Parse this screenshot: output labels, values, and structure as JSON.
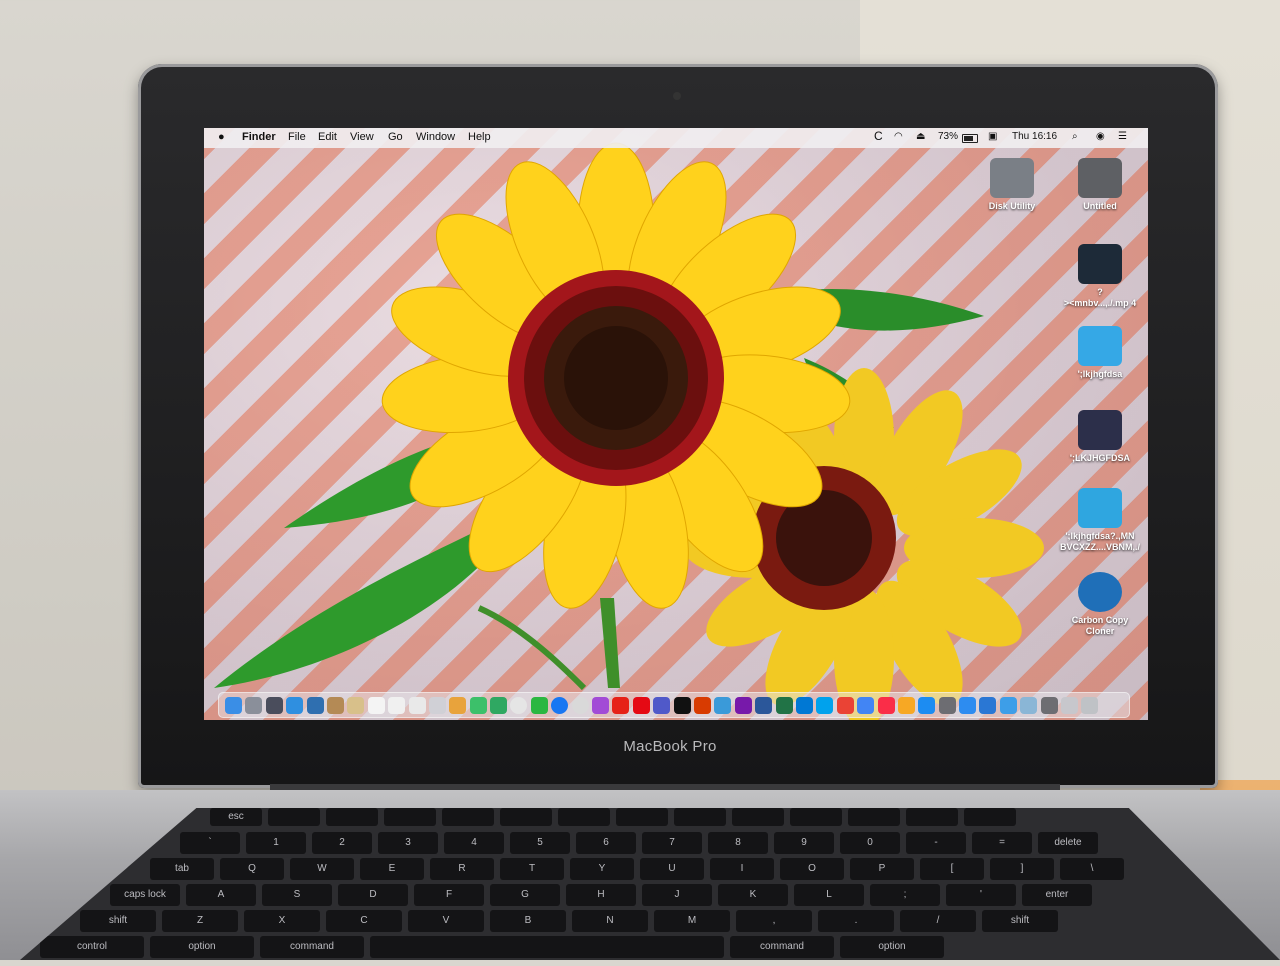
{
  "menubar": {
    "apple_icon": "apple-icon",
    "items": [
      "Finder",
      "File",
      "Edit",
      "View",
      "Go",
      "Window",
      "Help"
    ],
    "battery_percent": "73%",
    "clock": "Thu 16:16"
  },
  "desktop_icons": [
    {
      "label": "Disk Utility",
      "icon": "disk-utility-icon",
      "color": "#7a7f86"
    },
    {
      "label": "Untitled",
      "icon": "drive-icon",
      "color": "#5e6064"
    },
    {
      "label": "?\n><mnbv...,./.mp 4",
      "icon": "video-file-icon",
      "color": "#1d2a38"
    },
    {
      "label": "';lkjhgfdsa",
      "icon": "folder-icon",
      "color": "#35a8e6"
    },
    {
      "label": "';LKJHGFDSA",
      "icon": "keyboard-icon",
      "color": "#2c2f4a"
    },
    {
      "label": "';lkjhgfdsa?.,MN\nBVCXZZ....VBNM,./",
      "icon": "app-icon",
      "color": "#2fa6e0"
    },
    {
      "label": "Carbon Copy\nCloner",
      "icon": "carbon-copy-cloner-icon",
      "color": "#1f6fb8"
    }
  ],
  "dock": {
    "icons": [
      {
        "name": "finder-icon",
        "color": "#3a8ee6"
      },
      {
        "name": "launchpad-icon",
        "color": "#8a8f9a"
      },
      {
        "name": "rocket-icon",
        "color": "#4a4d5c"
      },
      {
        "name": "safari-icon",
        "color": "#2f8fe0"
      },
      {
        "name": "preview-icon",
        "color": "#2f6fb0"
      },
      {
        "name": "mail-icon",
        "color": "#b48a55"
      },
      {
        "name": "notes-icon",
        "color": "#d8c08a"
      },
      {
        "name": "calendar-icon",
        "color": "#f4f4f4"
      },
      {
        "name": "reminders-icon",
        "color": "#f0f0f0"
      },
      {
        "name": "textedit-icon",
        "color": "#e9e9e9"
      },
      {
        "name": "app-icon",
        "color": "#d0d0d6"
      },
      {
        "name": "photos-icon",
        "color": "#e8a33c"
      },
      {
        "name": "messages-icon",
        "color": "#3cc06a"
      },
      {
        "name": "facetime-icon",
        "color": "#2fa862"
      },
      {
        "name": "chrome-icon",
        "color": "#e5e5e5"
      },
      {
        "name": "whatsapp-icon",
        "color": "#2bb741"
      },
      {
        "name": "facebook-icon",
        "color": "#1877f2"
      },
      {
        "name": "help-icon",
        "color": "#d9d9d9"
      },
      {
        "name": "messenger-icon",
        "color": "#a24bd6"
      },
      {
        "name": "youtube-icon",
        "color": "#e62117"
      },
      {
        "name": "netflix-icon",
        "color": "#e50914"
      },
      {
        "name": "teams-icon",
        "color": "#5059c9"
      },
      {
        "name": "tiktok-icon",
        "color": "#111111"
      },
      {
        "name": "office-icon",
        "color": "#d83b01"
      },
      {
        "name": "app-icon",
        "color": "#3a9ad9"
      },
      {
        "name": "onenote-icon",
        "color": "#7719aa"
      },
      {
        "name": "word-icon",
        "color": "#2b579a"
      },
      {
        "name": "excel-icon",
        "color": "#217346"
      },
      {
        "name": "outlook-icon",
        "color": "#0078d4"
      },
      {
        "name": "app-icon",
        "color": "#00a2ed"
      },
      {
        "name": "gmail-icon",
        "color": "#ea4335"
      },
      {
        "name": "docs-icon",
        "color": "#4285f4"
      },
      {
        "name": "music-icon",
        "color": "#fa2d48"
      },
      {
        "name": "app-icon",
        "color": "#f7a824"
      },
      {
        "name": "appstore-icon",
        "color": "#1c8cf2"
      },
      {
        "name": "settings-icon",
        "color": "#6d6d72"
      },
      {
        "name": "app-icon",
        "color": "#2d8cf0"
      },
      {
        "name": "wps-icon",
        "color": "#2a77d4"
      },
      {
        "name": "app-icon",
        "color": "#3d9ee8"
      },
      {
        "name": "app-icon",
        "color": "#8ab6d6"
      },
      {
        "name": "app-icon",
        "color": "#6d6d72"
      },
      {
        "name": "downloads-icon",
        "color": "#c7c7cc"
      },
      {
        "name": "trash-icon",
        "color": "#bfc2c6"
      }
    ]
  },
  "laptop": {
    "brand": "MacBook Pro"
  },
  "keyboard": {
    "rows": [
      [
        "esc",
        "",
        "",
        "",
        "",
        "",
        "",
        "",
        "",
        "",
        "",
        "",
        "",
        ""
      ],
      [
        "`",
        "1",
        "2",
        "3",
        "4",
        "5",
        "6",
        "7",
        "8",
        "9",
        "0",
        "-",
        "=",
        "delete"
      ],
      [
        "tab",
        "Q",
        "W",
        "E",
        "R",
        "T",
        "Y",
        "U",
        "I",
        "O",
        "P",
        "[",
        "]",
        "\\"
      ],
      [
        "caps lock",
        "A",
        "S",
        "D",
        "F",
        "G",
        "H",
        "J",
        "K",
        "L",
        ";",
        "'",
        "enter"
      ],
      [
        "shift",
        "Z",
        "X",
        "C",
        "V",
        "B",
        "N",
        "M",
        ",",
        ".",
        "/",
        "shift"
      ],
      [
        "control",
        "option",
        "command",
        "",
        "command",
        "option"
      ]
    ]
  }
}
